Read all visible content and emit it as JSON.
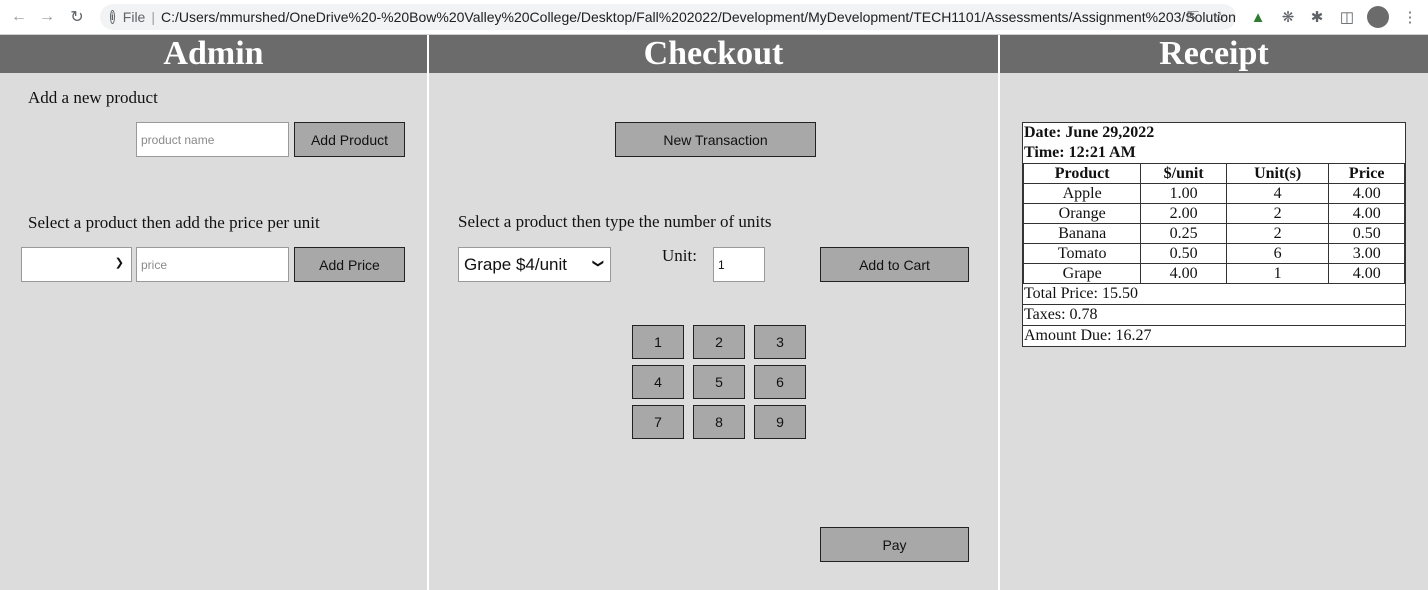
{
  "browser": {
    "scheme_label": "File",
    "url": "C:/Users/mmurshed/OneDrive%20-%20Bow%20Valley%20College/Desktop/Fall%202022/Development/MyDevelopment/TECH1101/Assessments/Assignment%203/Solution/i...",
    "icons": [
      "back-arrow-icon",
      "forward-arrow-icon",
      "reload-icon",
      "info-icon",
      "share-icon",
      "star-icon",
      "tree-extension-icon",
      "bug-extension-icon",
      "puzzle-extensions-icon",
      "side-panel-icon",
      "avatar",
      "kebab-menu-icon"
    ]
  },
  "admin": {
    "title": "Admin",
    "add_product_label": "Add a new product",
    "product_name_placeholder": "product name",
    "add_product_button": "Add Product",
    "price_label": "Select a product then add the price per unit",
    "product_select_value": "",
    "price_placeholder": "price",
    "add_price_button": "Add Price"
  },
  "checkout": {
    "title": "Checkout",
    "new_transaction_button": "New Transaction",
    "units_label": "Select a product then type the number of units",
    "product_select_value": "Grape $4/unit",
    "unit_label": "Unit:",
    "unit_value": "1",
    "add_to_cart_button": "Add to Cart",
    "keypad": [
      "1",
      "2",
      "3",
      "4",
      "5",
      "6",
      "7",
      "8",
      "9"
    ],
    "pay_button": "Pay"
  },
  "receipt": {
    "title": "Receipt",
    "date": "Date: June 29,2022",
    "time": "Time: 12:21 AM",
    "columns": [
      "Product",
      "$/unit",
      "Unit(s)",
      "Price"
    ],
    "rows": [
      [
        "Apple",
        "1.00",
        "4",
        "4.00"
      ],
      [
        "Orange",
        "2.00",
        "2",
        "4.00"
      ],
      [
        "Banana",
        "0.25",
        "2",
        "0.50"
      ],
      [
        "Tomato",
        "0.50",
        "6",
        "3.00"
      ],
      [
        "Grape",
        "4.00",
        "1",
        "4.00"
      ]
    ],
    "total_price": "Total Price: 15.50",
    "taxes": "Taxes: 0.78",
    "amount_due": "Amount Due: 16.27"
  }
}
